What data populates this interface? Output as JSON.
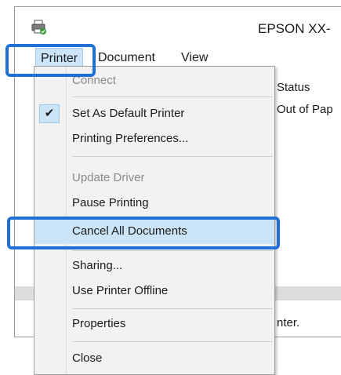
{
  "window": {
    "title": "EPSON XX-",
    "icon": "printer-icon"
  },
  "menubar": {
    "items": [
      "Printer",
      "Document",
      "View"
    ]
  },
  "content": {
    "column_status": "Status",
    "status_value": "Out of Pap",
    "status_text": "nter."
  },
  "dropdown": {
    "items": [
      {
        "label": "Connect",
        "disabled": true
      },
      {
        "label": "Set As Default Printer",
        "checked": true
      },
      {
        "label": "Printing Preferences..."
      },
      {
        "label": "Update Driver",
        "disabled": true
      },
      {
        "label": "Pause Printing"
      },
      {
        "label": "Cancel All Documents",
        "highlighted": true
      },
      {
        "label": "Sharing..."
      },
      {
        "label": "Use Printer Offline"
      },
      {
        "label": "Properties"
      },
      {
        "label": "Close"
      }
    ],
    "check_mark": "✔"
  },
  "colors": {
    "highlight_border": "#1f6fd6",
    "menu_hover": "#cce4f7",
    "menu_background": "#f2f2f2"
  }
}
